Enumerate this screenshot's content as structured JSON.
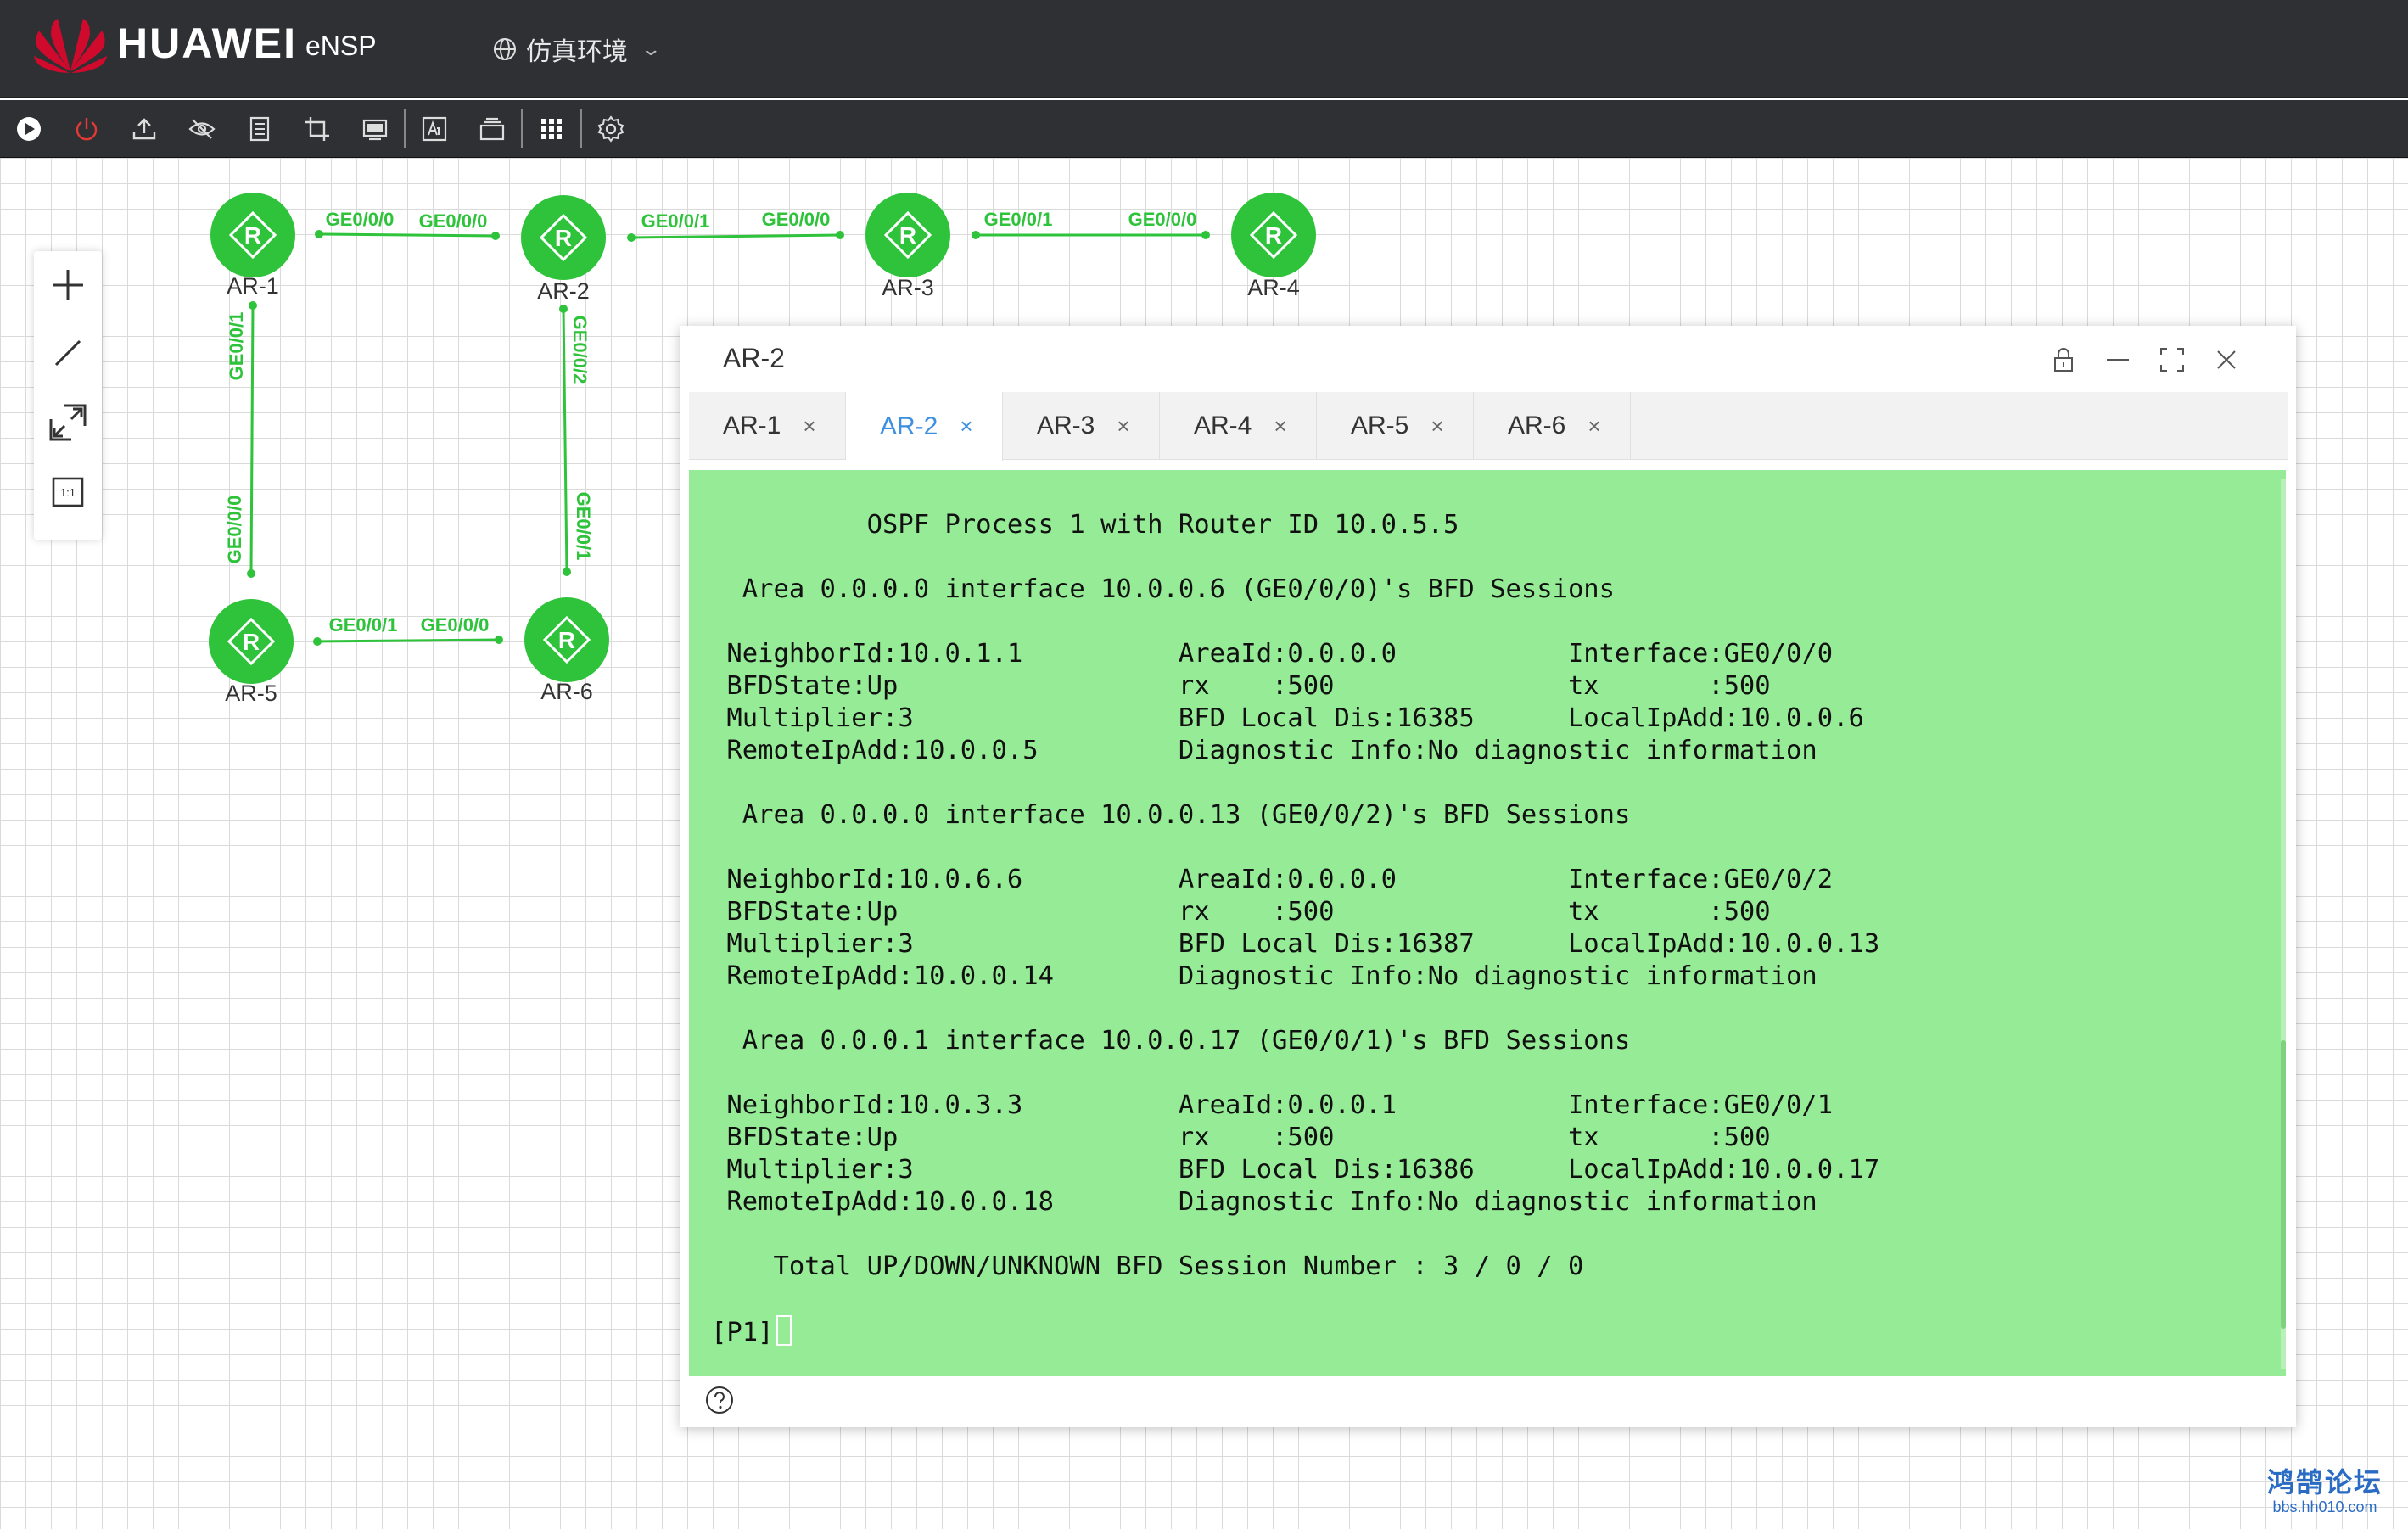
{
  "header": {
    "brand": "HUAWEI",
    "product": "eNSP",
    "environment": "仿真环境"
  },
  "toolbar": {
    "icons": [
      "play-icon",
      "power-icon",
      "upload-icon",
      "hide-icon",
      "document-icon",
      "crop-icon",
      "screen-icon",
      "text-icon",
      "layers-icon",
      "grid-icon",
      "settings-icon"
    ]
  },
  "side_tools": [
    "add-icon",
    "line-icon",
    "fit-screen-icon",
    "actual-size-icon"
  ],
  "actual_size_label": "1:1",
  "topology": {
    "color": "#2ec33b",
    "nodes": [
      "AR-1",
      "AR-2",
      "AR-3",
      "AR-4",
      "AR-5",
      "AR-6"
    ],
    "links": [
      {
        "from": "AR-1",
        "to": "AR-2",
        "from_port": "GE0/0/0",
        "to_port": "GE0/0/0"
      },
      {
        "from": "AR-2",
        "to": "AR-3",
        "from_port": "GE0/0/1",
        "to_port": "GE0/0/0"
      },
      {
        "from": "AR-3",
        "to": "AR-4",
        "from_port": "GE0/0/1",
        "to_port": "GE0/0/0"
      },
      {
        "from": "AR-1",
        "to": "AR-5",
        "from_port": "GE0/0/1",
        "to_port": "GE0/0/0"
      },
      {
        "from": "AR-2",
        "to": "AR-6",
        "from_port": "GE0/0/2",
        "to_port": "GE0/0/1"
      },
      {
        "from": "AR-5",
        "to": "AR-6",
        "from_port": "GE0/0/1",
        "to_port": "GE0/0/0"
      }
    ]
  },
  "console": {
    "title": "AR-2",
    "tabs": [
      {
        "label": "AR-1",
        "active": false
      },
      {
        "label": "AR-2",
        "active": true
      },
      {
        "label": "AR-3",
        "active": false
      },
      {
        "label": "AR-4",
        "active": false
      },
      {
        "label": "AR-5",
        "active": false
      },
      {
        "label": "AR-6",
        "active": false
      }
    ],
    "tab_close": "×",
    "background": "#96ec96",
    "output": "          OSPF Process 1 with Router ID 10.0.5.5\n\n  Area 0.0.0.0 interface 10.0.0.6 (GE0/0/0)'s BFD Sessions\n\n NeighborId:10.0.1.1          AreaId:0.0.0.0           Interface:GE0/0/0\n BFDState:Up                  rx    :500               tx       :500\n Multiplier:3                 BFD Local Dis:16385      LocalIpAdd:10.0.0.6\n RemoteIpAdd:10.0.0.5         Diagnostic Info:No diagnostic information\n\n  Area 0.0.0.0 interface 10.0.0.13 (GE0/0/2)'s BFD Sessions\n\n NeighborId:10.0.6.6          AreaId:0.0.0.0           Interface:GE0/0/2\n BFDState:Up                  rx    :500               tx       :500\n Multiplier:3                 BFD Local Dis:16387      LocalIpAdd:10.0.0.13\n RemoteIpAdd:10.0.0.14        Diagnostic Info:No diagnostic information\n\n  Area 0.0.0.1 interface 10.0.0.17 (GE0/0/1)'s BFD Sessions\n\n NeighborId:10.0.3.3          AreaId:0.0.0.1           Interface:GE0/0/1\n BFDState:Up                  rx    :500               tx       :500\n Multiplier:3                 BFD Local Dis:16386      LocalIpAdd:10.0.0.17\n RemoteIpAdd:10.0.0.18        Diagnostic Info:No diagnostic information\n\n    Total UP/DOWN/UNKNOWN BFD Session Number : 3 / 0 / 0\n\n",
    "prompt": "[P1]"
  },
  "watermark": {
    "line1": "鸿鹄论坛",
    "line2": "bbs.hh010.com"
  }
}
